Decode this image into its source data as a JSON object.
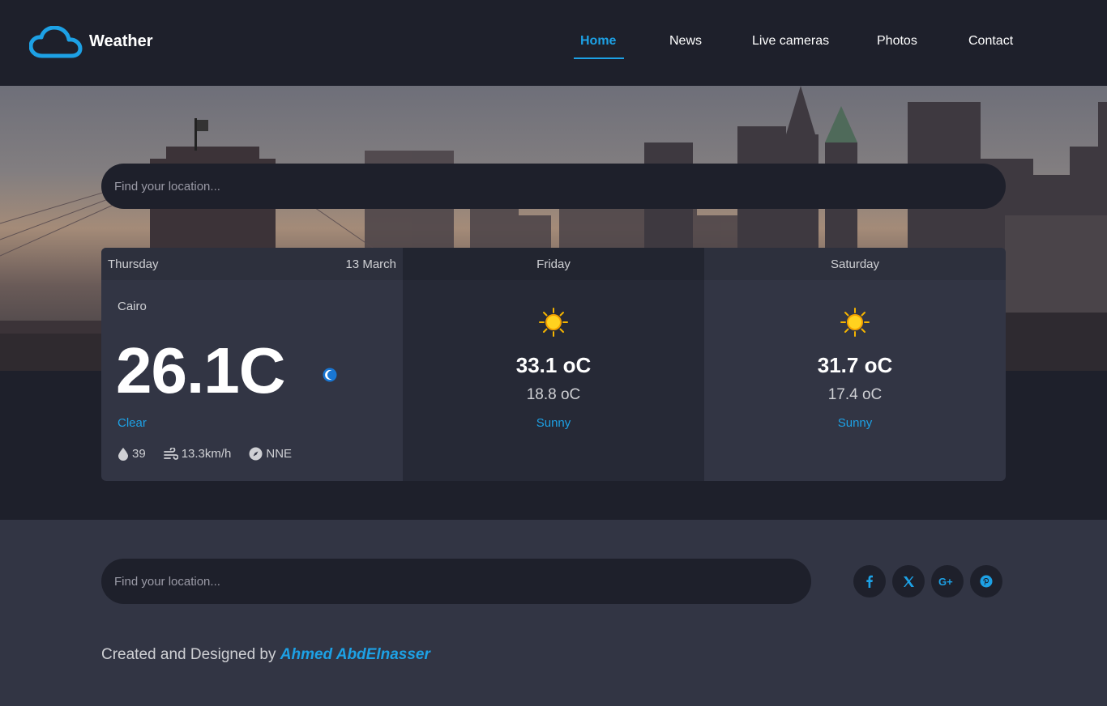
{
  "brand": {
    "name": "Weather",
    "icon": "cloud-icon"
  },
  "nav": {
    "items": [
      {
        "label": "Home",
        "active": true
      },
      {
        "label": "News",
        "active": false
      },
      {
        "label": "Live cameras",
        "active": false
      },
      {
        "label": "Photos",
        "active": false
      },
      {
        "label": "Contact",
        "active": false
      }
    ]
  },
  "search": {
    "placeholder": "Find your location...",
    "value": ""
  },
  "forecast": {
    "today": {
      "day": "Thursday",
      "date": "13 March",
      "city": "Cairo",
      "temp": "26.1C",
      "condition": "Clear",
      "condition_icon": "moon-icon",
      "humidity": "39",
      "wind": "13.3km/h",
      "direction": "NNE"
    },
    "days": [
      {
        "day": "Friday",
        "max": "33.1 oC",
        "min": "18.8 oC",
        "condition": "Sunny",
        "icon": "sun-icon"
      },
      {
        "day": "Saturday",
        "max": "31.7 oC",
        "min": "17.4 oC",
        "condition": "Sunny",
        "icon": "sun-icon"
      }
    ]
  },
  "footer": {
    "search_placeholder": "Find your location...",
    "social": [
      "facebook-icon",
      "x-icon",
      "google-plus-icon",
      "pinterest-icon"
    ],
    "credit_prefix": "Created and Designed by ",
    "credit_name": "Ahmed AbdElnasser"
  },
  "colors": {
    "accent": "#1da1e5",
    "background": "#1e202b",
    "card": "#323544",
    "card_alt": "#262936",
    "sun": "#f5b400"
  }
}
